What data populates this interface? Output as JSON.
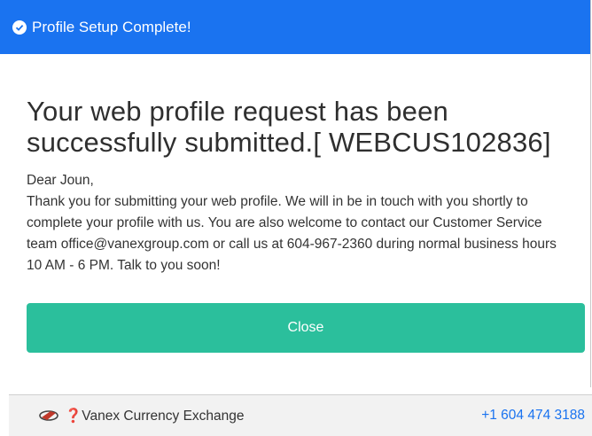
{
  "header": {
    "title": "Profile Setup Complete!",
    "icon": "check-circle-icon",
    "color": "#1a73f0"
  },
  "body": {
    "heading": "Your web profile request has been successfully submitted.[ WEBCUS102836]",
    "greeting": "Dear Joun,",
    "message": "Thank you for submitting your web profile. We will in be in touch with you shortly to complete your profile with us. You are also welcome to contact our Customer Service team office@vanexgroup.com or call us at 604-967-2360 during normal business hours 10 AM - 6 PM. Talk to you soon!"
  },
  "close_button": {
    "label": "Close",
    "color": "#2bbf9c"
  },
  "footer": {
    "logo_icon": "vanex-logo-icon",
    "brand": "❓Vanex Currency Exchange",
    "phone": "+1 604 474 3188"
  }
}
